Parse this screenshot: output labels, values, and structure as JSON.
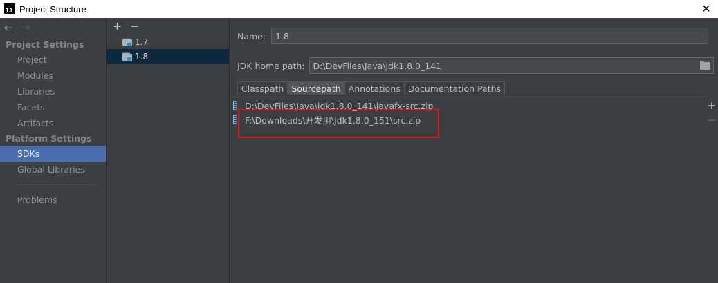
{
  "window": {
    "title": "Project Structure",
    "logo_text": "IJ",
    "close_glyph": "✕"
  },
  "nav": {
    "back_glyph": "←",
    "forward_glyph": "→",
    "project_settings_header": "Project Settings",
    "project_items": [
      "Project",
      "Modules",
      "Libraries",
      "Facets",
      "Artifacts"
    ],
    "platform_settings_header": "Platform Settings",
    "platform_items": [
      "SDKs",
      "Global Libraries"
    ],
    "selected": "SDKs",
    "problems": "Problems"
  },
  "sdk_list": {
    "add_glyph": "+",
    "remove_glyph": "−",
    "items": [
      "1.7",
      "1.8"
    ],
    "selected": "1.8"
  },
  "details": {
    "name_label": "Name:",
    "name_value": "1.8",
    "jdk_home_label": "JDK home path:",
    "jdk_home_value": "D:\\DevFiles\\Java\\jdk1.8.0_141",
    "tabs": [
      "Classpath",
      "Sourcepath",
      "Annotations",
      "Documentation Paths"
    ],
    "active_tab": "Sourcepath",
    "paths": [
      "D:\\DevFiles\\Java\\jdk1.8.0_141\\javafx-src.zip",
      "F:\\Downloads\\开发用\\jdk1.8.0_151\\src.zip"
    ],
    "side_add_glyph": "+",
    "side_remove_glyph": "−"
  },
  "colors": {
    "accent_selection": "#4b6eaf",
    "annotation_box": "#e0141a"
  }
}
